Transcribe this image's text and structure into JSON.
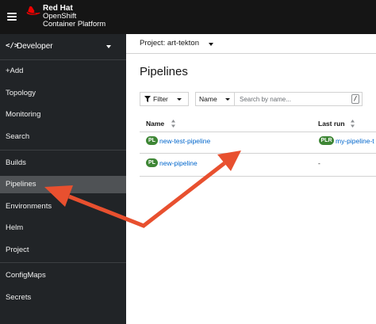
{
  "masthead": {
    "brand_line1": "Red Hat",
    "brand_line2": "OpenShift",
    "brand_line3": "Container Platform",
    "menu_icon": "hamburger-icon",
    "logo_icon": "redhat-logo-icon",
    "background_color": "#151515"
  },
  "sidebar": {
    "perspective": {
      "icon": "</>",
      "label": "Developer"
    },
    "items": [
      {
        "label": "+Add"
      },
      {
        "label": "Topology"
      },
      {
        "label": "Monitoring"
      },
      {
        "label": "Search"
      },
      {
        "label": "Builds"
      },
      {
        "label": "Pipelines",
        "active": true
      },
      {
        "label": "Environments"
      },
      {
        "label": "Helm"
      },
      {
        "label": "Project"
      },
      {
        "label": "ConfigMaps"
      },
      {
        "label": "Secrets"
      }
    ],
    "background_color": "#212427",
    "active_color": "#4f5255"
  },
  "project": {
    "label": "Project: art-tekton"
  },
  "page": {
    "title": "Pipelines"
  },
  "toolbar": {
    "filter_label": "Filter",
    "filter_icon": "filter-icon",
    "name_select": "Name",
    "search_placeholder": "Search by name...",
    "search_value": "",
    "search_shortcut": "/"
  },
  "table": {
    "columns": [
      "Name",
      "Last run"
    ],
    "rows": [
      {
        "badge": "PL",
        "name": "new-test-pipeline",
        "last_run_badge": "PLR",
        "last_run": "my-pipeline-t"
      },
      {
        "badge": "PL",
        "name": "new-pipeline",
        "last_run": "-"
      }
    ],
    "badge_color": "#3e8635",
    "link_color": "#0066cc"
  },
  "annotation": {
    "arrow_color": "#e8502f"
  }
}
